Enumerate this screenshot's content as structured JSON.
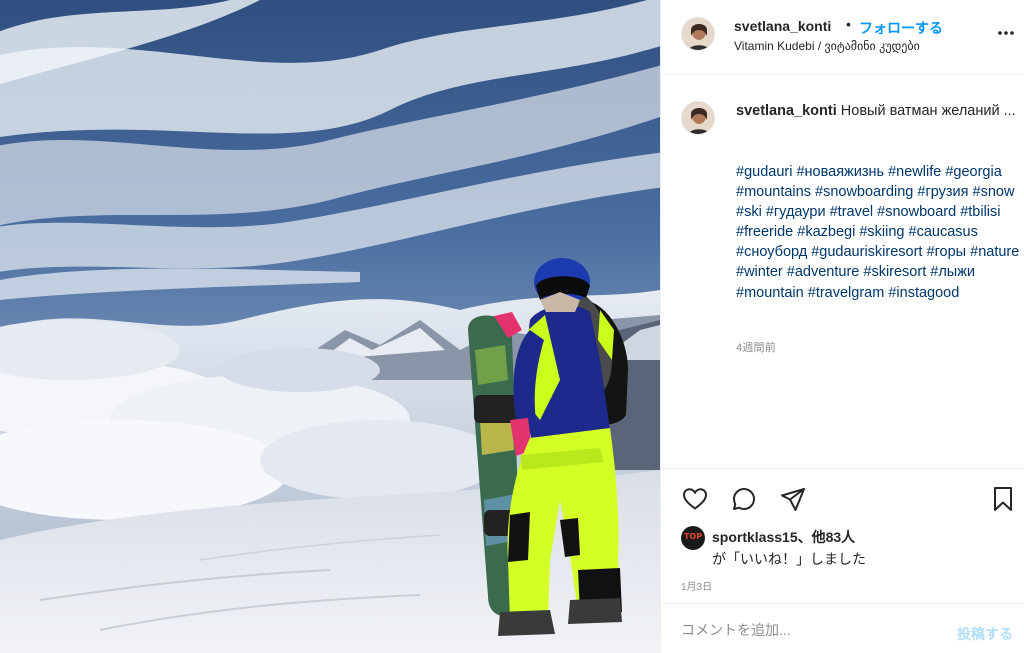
{
  "post": {
    "username": "svetlana_konti",
    "follow_label": "フォローする",
    "dot": "•",
    "location": "Vitamin Kudebi / ვიტამინი კუდები",
    "caption_text": "Новый ватман желаний ...",
    "hashtags": [
      "#gudauri",
      "#новаяжизнь",
      "#newlife",
      "#georgia",
      "#mountains",
      "#snowboarding",
      "#грузия",
      "#snow",
      "#ski",
      "#гудаури",
      "#travel",
      "#snowboard",
      "#tbilisi",
      "#freeride",
      "#kazbegi",
      "#skiing",
      "#caucasus",
      "#сноуборд",
      "#gudauriskiresort",
      "#горы",
      "#nature",
      "#winter",
      "#adventure",
      "#skiresort",
      "#лыжи",
      "#mountain",
      "#travelgram",
      "#instagood"
    ],
    "time_ago": "4週間前",
    "likes_user": "sportklass15",
    "likes_rest": "、他83人",
    "likes_line2": "が「いいね！」しました",
    "likes_avatar_text": "TOP",
    "date": "1月3日",
    "comment_placeholder": "コメントを追加...",
    "post_label": "投稿する"
  },
  "icons": {
    "more": "more-horizontal-icon",
    "like": "heart-icon",
    "comment": "comment-bubble-icon",
    "share": "paper-plane-icon",
    "save": "bookmark-icon"
  },
  "colors": {
    "follow": "#0095f6",
    "hashtag": "#00376b",
    "muted": "#8e8e8e",
    "post_disabled": "#b2dffc"
  }
}
